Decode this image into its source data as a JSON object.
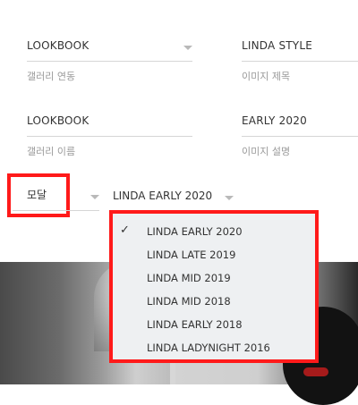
{
  "form": {
    "gallery_link": {
      "value": "LOOKBOOK",
      "hint": "갤러리 연동"
    },
    "image_title": {
      "value": "LINDA STYLE",
      "hint": "이미지 제목"
    },
    "gallery_name": {
      "value": "LOOKBOOK",
      "hint": "갤러리 이름"
    },
    "image_desc": {
      "value": "EARLY 2020",
      "hint": "이미지 설명"
    },
    "modal": {
      "value": "모달"
    },
    "year": {
      "value": "LINDA EARLY 2020"
    }
  },
  "dropdown": {
    "check_symbol": "✓",
    "options": [
      {
        "label": "LINDA EARLY 2020",
        "selected": true
      },
      {
        "label": "LINDA LATE 2019",
        "selected": false
      },
      {
        "label": "LINDA MID 2019",
        "selected": false
      },
      {
        "label": "LINDA MID 2018",
        "selected": false
      },
      {
        "label": "LINDA EARLY 2018",
        "selected": false
      },
      {
        "label": "LINDA LADYNIGHT 2016",
        "selected": false
      }
    ]
  },
  "colors": {
    "highlight": "#ff1a1a",
    "dropdown_bg": "#eef0f2"
  }
}
